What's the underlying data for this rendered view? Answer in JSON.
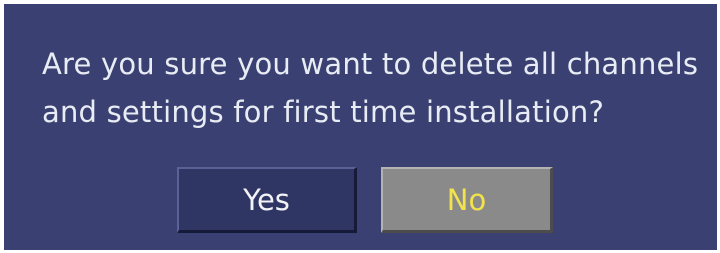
{
  "dialog": {
    "message": "Are you sure you want to delete all channels and settings for first time installation?",
    "buttons": {
      "yes_label": "Yes",
      "no_label": "No",
      "selected": "No"
    },
    "colors": {
      "background": "#3a4071",
      "text": "#e8ecf4",
      "yes_button_bg": "#2f3664",
      "no_button_bg": "#8a8a8a",
      "selected_text": "#f2e34a"
    }
  }
}
